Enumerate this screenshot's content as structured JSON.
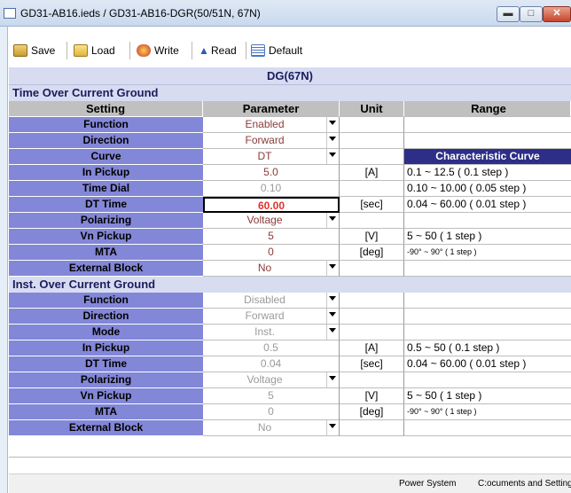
{
  "window": {
    "title": "GD31-AB16.ieds / GD31-AB16-DGR(50/51N, 67N)"
  },
  "toolbar": [
    {
      "label": "Save",
      "icon": "save-icon"
    },
    {
      "label": "Load",
      "icon": "folder-icon"
    },
    {
      "label": "Write",
      "icon": "write-icon"
    },
    {
      "label": "Read",
      "icon": "read-icon"
    },
    {
      "label": "Default",
      "icon": "default-icon"
    }
  ],
  "table": {
    "title": "DG(67N)",
    "columns": [
      "Setting",
      "Parameter",
      "Unit",
      "Range"
    ],
    "sections": [
      {
        "name": "Time Over Current Ground",
        "rows": [
          {
            "setting": "Function",
            "parameter": "Enabled",
            "unit": "",
            "range": "",
            "dropdown": true
          },
          {
            "setting": "Direction",
            "parameter": "Forward",
            "unit": "",
            "range": "",
            "dropdown": true
          },
          {
            "setting": "Curve",
            "parameter": "DT",
            "unit": "",
            "range": "Characteristic Curve",
            "dropdown": true
          },
          {
            "setting": "In Pickup",
            "parameter": "5.0",
            "unit": "[A]",
            "range": "0.1 ~ 12.5 ( 0.1 step )"
          },
          {
            "setting": "Time Dial",
            "parameter": "0.10",
            "unit": "",
            "range": "0.10 ~ 10.00 ( 0.05 step )"
          },
          {
            "setting": "DT Time",
            "parameter": "60.00",
            "unit": "[sec]",
            "range": "0.04 ~ 60.00 ( 0.01 step )"
          },
          {
            "setting": "Polarizing",
            "parameter": "Voltage",
            "unit": "",
            "range": "",
            "dropdown": true
          },
          {
            "setting": "Vn Pickup",
            "parameter": "5",
            "unit": "[V]",
            "range": "5 ~ 50 ( 1 step )"
          },
          {
            "setting": "MTA",
            "parameter": "0",
            "unit": "[deg]",
            "range": "-90° ~ 90° ( 1 step )"
          },
          {
            "setting": "External Block",
            "parameter": "No",
            "unit": "",
            "range": "",
            "dropdown": true
          }
        ]
      },
      {
        "name": "Inst. Over Current Ground",
        "rows": [
          {
            "setting": "Function",
            "parameter": "Disabled",
            "unit": "",
            "range": "",
            "dropdown": true
          },
          {
            "setting": "Direction",
            "parameter": "Forward",
            "unit": "",
            "range": "",
            "dropdown": true
          },
          {
            "setting": "Mode",
            "parameter": "Inst.",
            "unit": "",
            "range": "",
            "dropdown": true
          },
          {
            "setting": "In Pickup",
            "parameter": "0.5",
            "unit": "[A]",
            "range": "0.5 ~ 50 ( 0.1 step )"
          },
          {
            "setting": "DT Time",
            "parameter": "0.04",
            "unit": "[sec]",
            "range": "0.04 ~ 60.00 ( 0.01 step )"
          },
          {
            "setting": "Polarizing",
            "parameter": "Voltage",
            "unit": "",
            "range": "",
            "dropdown": true
          },
          {
            "setting": "Vn Pickup",
            "parameter": "5",
            "unit": "[V]",
            "range": "5 ~ 50 ( 1 step )"
          },
          {
            "setting": "MTA",
            "parameter": "0",
            "unit": "[deg]",
            "range": "-90° ~ 90° ( 1 step )"
          },
          {
            "setting": "External Block",
            "parameter": "No",
            "unit": "",
            "range": "",
            "dropdown": true
          }
        ]
      }
    ]
  },
  "status": {
    "left": "Power System",
    "right": "C:ocuments and Settings•l Po"
  },
  "colors": {
    "setting_cell": "#8387d8",
    "section_bg": "#d7dcf1",
    "param_text": "#8b3a3a",
    "char_curve_bg": "#2d2e88"
  }
}
